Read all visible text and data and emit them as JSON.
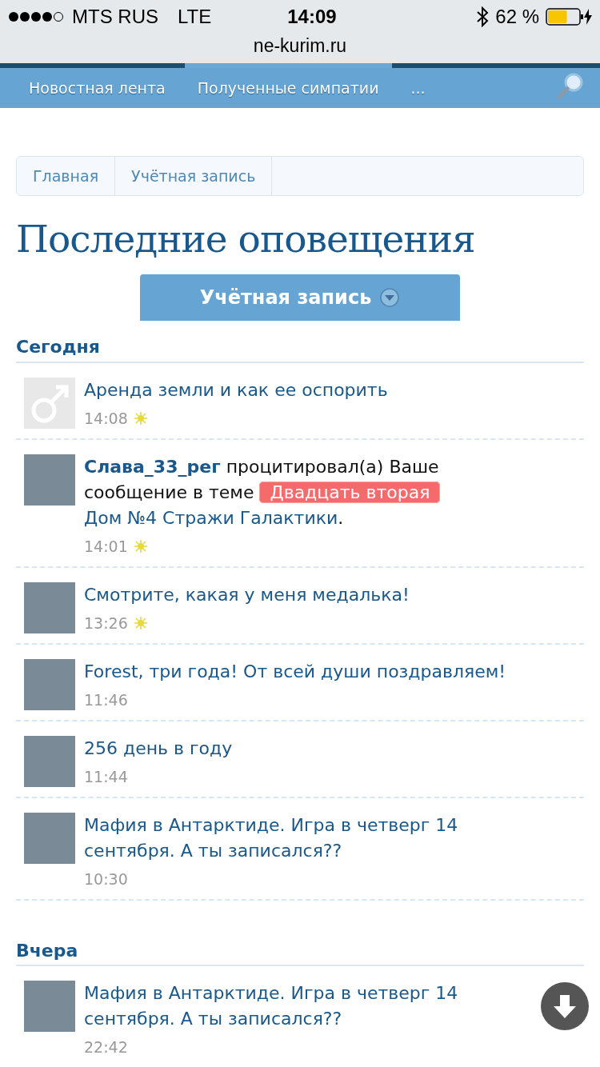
{
  "status_bar": {
    "carrier": "MTS RUS",
    "network": "LTE",
    "time": "14:09",
    "battery": "62 %",
    "charging": true
  },
  "address_bar": {
    "url": "ne-kurim.ru"
  },
  "nav_tabs": [
    {
      "label": "Новостная лента",
      "selected": false
    },
    {
      "label": "Полученные симпатии",
      "selected": true
    },
    {
      "label": "...",
      "selected": false
    }
  ],
  "breadcrumbs": [
    "Главная",
    "Учётная запись"
  ],
  "page_title": "Последние оповещения",
  "account_button": "Учётная запись",
  "sections": [
    {
      "heading": "Сегодня",
      "items": [
        {
          "kind": "link",
          "has_photo": false,
          "text": "Аренда земли и как ее оспорить",
          "time": "14:08",
          "unread": true
        },
        {
          "kind": "quote",
          "has_photo": true,
          "user": "Слава_33_рег",
          "action": "процитировал(а) Ваше сообщение в теме",
          "prefix": "Двадцать вторая",
          "thread": "Дом №4 Стражи Галактики",
          "end": ".",
          "time": "14:01",
          "unread": true
        },
        {
          "kind": "link",
          "has_photo": true,
          "text": "Смотрите, какая у меня медалька!",
          "time": "13:26",
          "unread": true
        },
        {
          "kind": "link",
          "has_photo": true,
          "text": "Forest, три года! От всей души поздравляем!",
          "time": "11:46",
          "unread": false
        },
        {
          "kind": "link",
          "has_photo": true,
          "text": "256 день в году",
          "time": "11:44",
          "unread": false
        },
        {
          "kind": "link",
          "has_photo": true,
          "text": "Мафия в Антарктиде. Игра в четверг 14 сентября. А ты записался??",
          "time": "10:30",
          "unread": false
        }
      ]
    },
    {
      "heading": "Вчера",
      "items": [
        {
          "kind": "link",
          "has_photo": true,
          "text": "Мафия в Антарктиде. Игра в четверг 14 сентября. А ты записался??",
          "time": "22:42",
          "unread": false
        }
      ]
    }
  ]
}
